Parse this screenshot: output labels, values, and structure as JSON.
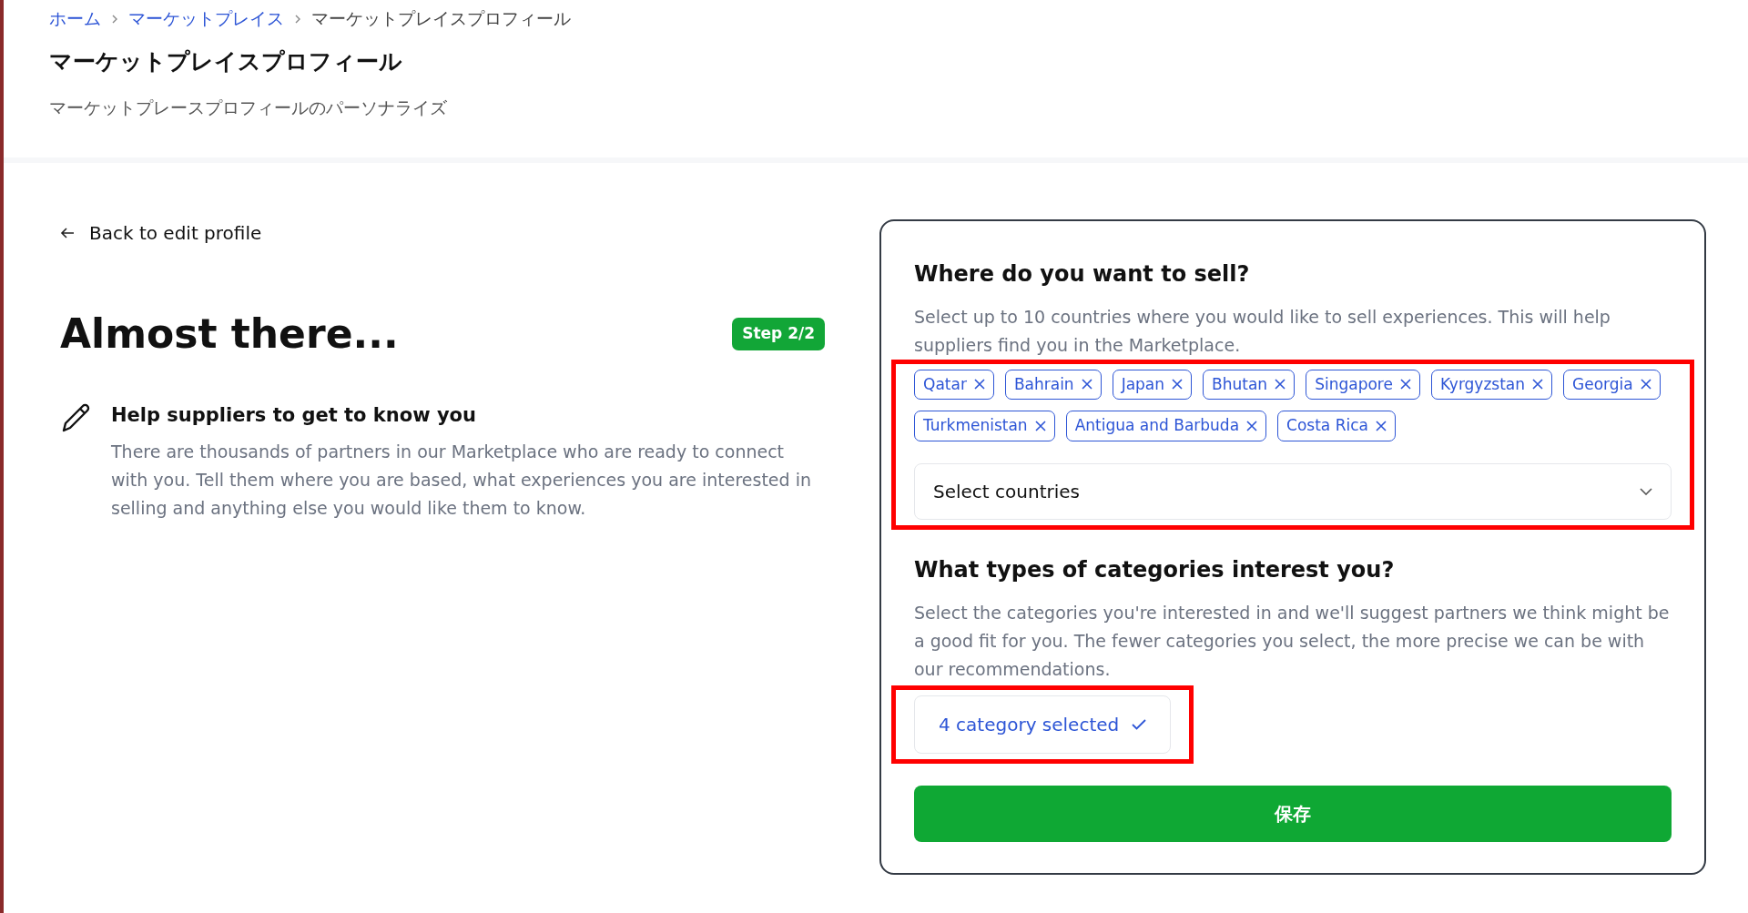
{
  "breadcrumb": [
    {
      "label": "ホーム",
      "link": true
    },
    {
      "label": "マーケットプレイス",
      "link": true
    },
    {
      "label": "マーケットプレイスプロフィール",
      "link": false
    }
  ],
  "page_title": "マーケットプレイスプロフィール",
  "page_subtitle": "マーケットプレースプロフィールのパーソナライズ",
  "back_link": "Back to edit profile",
  "heading": "Almost there...",
  "step_badge": "Step 2/2",
  "intro": {
    "title": "Help suppliers to get to know you",
    "text": "There are thousands of partners in our Marketplace who are ready to connect with you. Tell them where you are based, what experiences you are interested in selling and anything else you would like them to know."
  },
  "countries": {
    "title": "Where do you want to sell?",
    "text": "Select up to 10 countries where you would like to sell experiences. This will help suppliers find you in the Marketplace.",
    "highlighted": true,
    "chips": [
      "Qatar",
      "Bahrain",
      "Japan",
      "Bhutan",
      "Singapore",
      "Kyrgyzstan",
      "Georgia",
      "Turkmenistan",
      "Antigua and Barbuda",
      "Costa Rica"
    ],
    "select": {
      "placeholder": "Select countries"
    }
  },
  "categories": {
    "title": "What types of categories interest you?",
    "text": "Select the categories you're interested in and we'll suggest partners we think might be a good fit for you. The fewer categories you select, the more precise we can be with our recommendations.",
    "highlighted": true,
    "button": "4 category selected"
  },
  "save_button": "保存"
}
